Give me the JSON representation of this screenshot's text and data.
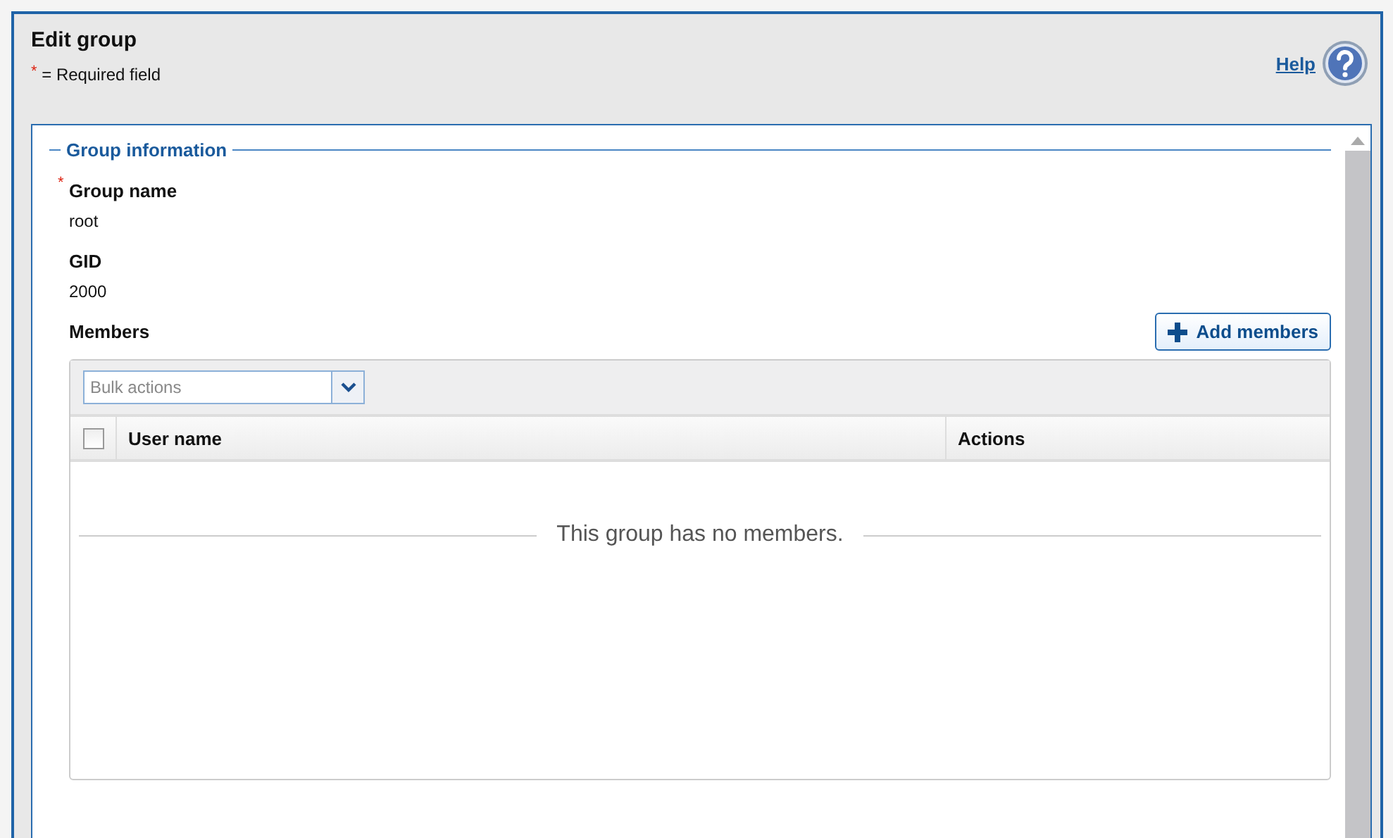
{
  "window": {
    "title": "Edit group"
  },
  "required_note": {
    "marker": "*",
    "text": "= Required field"
  },
  "help": {
    "label": "Help"
  },
  "section": {
    "legend": "Group information"
  },
  "fields": [
    {
      "label": "Group name",
      "required": true,
      "value": "root"
    },
    {
      "label": "GID",
      "required": false,
      "value": "2000"
    }
  ],
  "members": {
    "label": "Members",
    "add_button": "Add members",
    "bulk_actions": {
      "placeholder": "Bulk actions"
    },
    "table": {
      "select_all": {
        "checked": false
      },
      "columns": [
        "User name",
        "Actions"
      ],
      "empty_message": "This group has no members."
    }
  }
}
